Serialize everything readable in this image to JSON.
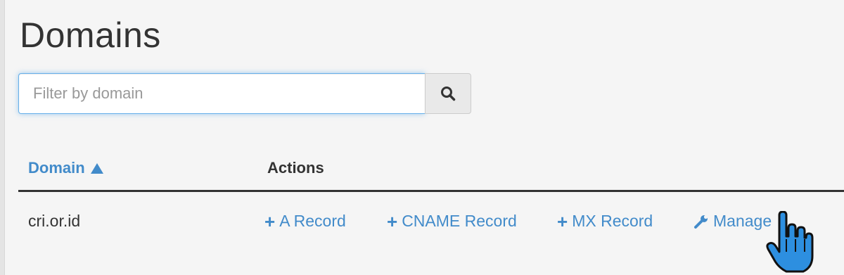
{
  "page": {
    "title": "Domains"
  },
  "search": {
    "placeholder": "Filter by domain",
    "value": ""
  },
  "table": {
    "columns": [
      {
        "label": "Domain",
        "sort": "ascending"
      },
      {
        "label": "Actions"
      }
    ],
    "rows": [
      {
        "domain": "cri.or.id",
        "actions": [
          "A Record",
          "CNAME Record",
          "MX Record",
          "Manage"
        ]
      }
    ]
  },
  "colors": {
    "link": "#428bca",
    "focus": "#66afe9",
    "text": "#333333"
  },
  "icons": {
    "search": "search-icon",
    "sort": "sort-ascending-icon",
    "plus": "plus-icon",
    "manage": "wrench-icon",
    "cursor": "hand-pointer-icon"
  }
}
